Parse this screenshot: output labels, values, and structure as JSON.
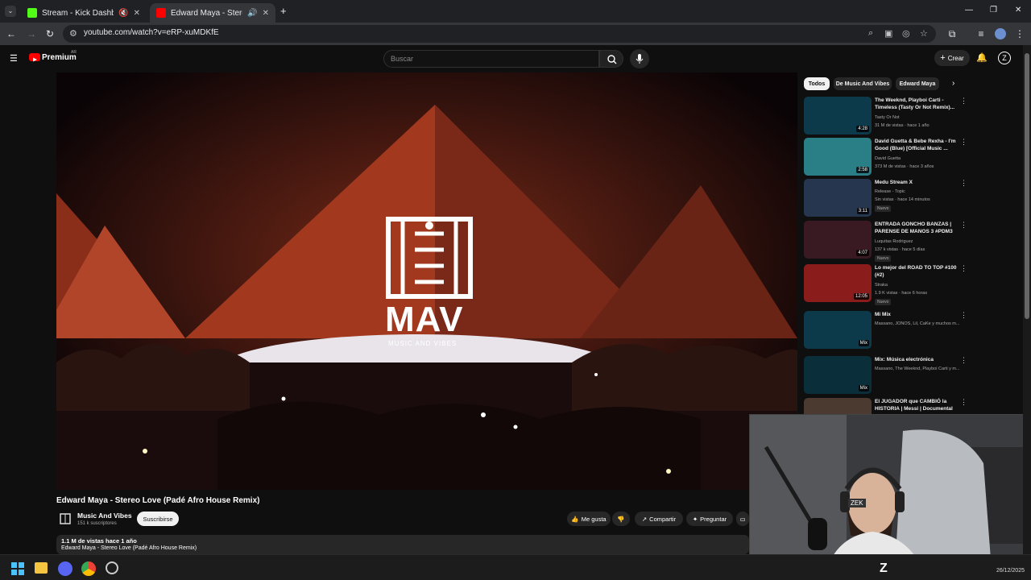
{
  "browser": {
    "tabs": [
      {
        "title": "Stream - Kick Dashboard",
        "color": "#53fc18",
        "active": false
      },
      {
        "title": "Edward Maya - Stereo Love",
        "color": "#ff0000",
        "active": true
      }
    ],
    "new_tab": "+",
    "url": "youtube.com/watch?v=eRP-xuMDKfE"
  },
  "youtube": {
    "logo": "Premium",
    "logo_country": "AR",
    "search_placeholder": "Buscar",
    "create_label": "Crear",
    "video": {
      "overlay_brand": "MAV",
      "overlay_tagline": "MUSIC AND VIBES",
      "title": "Edward Maya - Stereo Love (Padé Afro House Remix)",
      "channel": "Music And Vibes",
      "subscribers": "151 k suscriptores",
      "subscribe_label": "Suscribirse",
      "like_label": "Me gusta",
      "share_label": "Compartir",
      "ask_label": "Preguntar",
      "views_line": "1.1 M de vistas  hace 1 año",
      "desc_line": "Edward Maya - Stereo Love (Padé Afro House Remix)"
    },
    "chips": [
      "Todos",
      "De Music And Vibes",
      "Edward Maya"
    ],
    "recommendations": [
      {
        "title": "The Weeknd, Playboi Carti - Timeless (Tasty Or Not Remix)...",
        "channel": "Tasty Or Not",
        "meta": "31 M de vistas · hace 1 año",
        "duration": "4:28",
        "badge": "",
        "thumb_color": "#0c3a4a"
      },
      {
        "title": "David Guetta & Bebe Rexha - I'm Good (Blue) [Official Music ...",
        "channel": "David Guetta",
        "meta": "373 M de vistas · hace 3 años",
        "duration": "2:58",
        "badge": "",
        "thumb_color": "#2a7f86"
      },
      {
        "title": "Medu Stream X",
        "channel": "Release - Topic",
        "meta": "Sin vistas · hace 14 minutos",
        "duration": "3:11",
        "badge": "Nuevo",
        "thumb_color": "#27364f"
      },
      {
        "title": "ENTRADA GONCHO BANZAS | PARENSE DE MANOS 3 #PDM3",
        "channel": "Luquitas Rodriguez",
        "meta": "137 k vistas · hace 5 días",
        "duration": "4:07",
        "badge": "Nuevo",
        "thumb_color": "#3a1a22"
      },
      {
        "title": "Lo mejor del ROAD TO TOP #100 (#2)",
        "channel": "Straka",
        "meta": "1.9 K vistas · hace 6 horas",
        "duration": "12:05",
        "badge": "Nuevo",
        "thumb_color": "#8a1c1c"
      },
      {
        "title": "Mi Mix",
        "channel": "Massano, JONOS, Lil, CaKe y muchos m...",
        "meta": "",
        "duration": "Mix",
        "badge": "",
        "thumb_color": "#0c3a4a"
      },
      {
        "title": "Mix: Música electrónica",
        "channel": "Massano, The Weeknd, Playboi Carti y m...",
        "meta": "",
        "duration": "Mix",
        "badge": "",
        "thumb_color": "#0a2e3a"
      },
      {
        "title": "El JUGADOR que CAMBIÓ la HISTORIA | Messi | Documental",
        "channel": "",
        "meta": "",
        "duration": "",
        "badge": "",
        "thumb_color": "#4a3a30"
      }
    ]
  },
  "webcam": {
    "label": "ZEK"
  },
  "taskbar": {
    "date": "26/12/2025"
  }
}
